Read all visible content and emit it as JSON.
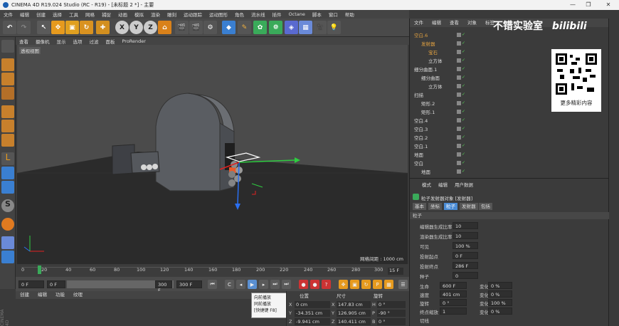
{
  "window": {
    "title": "CINEMA 4D R19.024 Studio (RC - R19) - [未标题 2 *] - 主要"
  },
  "menubar": [
    "文件",
    "编辑",
    "创建",
    "选择",
    "工具",
    "网格",
    "捕捉",
    "动画",
    "模拟",
    "渲染",
    "雕刻",
    "运动跟踪",
    "运动图形",
    "角色",
    "流水线",
    "插件",
    "Octane",
    "脚本",
    "窗口",
    "帮助"
  ],
  "toolbar": {
    "axis_x": "X",
    "axis_y": "Y",
    "axis_z": "Z"
  },
  "viewport": {
    "menu": [
      "查看",
      "摄像机",
      "显示",
      "选项",
      "过滤",
      "面板",
      "ProRender"
    ],
    "label": "透视视图",
    "grid_info": "网格间距 : 1000 cm"
  },
  "timeline": {
    "ticks": [
      "0",
      "20",
      "40",
      "60",
      "80",
      "100",
      "120",
      "140",
      "160",
      "180",
      "200",
      "220",
      "240",
      "260",
      "280",
      "300"
    ],
    "current": "15 F"
  },
  "transport": {
    "start": "0 F",
    "range_start": "0 F",
    "range_end": "300 F",
    "end": "300 F"
  },
  "tooltip": {
    "line1": "向前播放",
    "line2": "同前播放",
    "line3": "[快捷键 F8]"
  },
  "materials": {
    "menu": [
      "创建",
      "编辑",
      "功能",
      "纹理"
    ],
    "logo": "CINEMA 4D"
  },
  "coords": {
    "headers": {
      "pos": "位置",
      "size": "尺寸",
      "rot": "旋转"
    },
    "rows": [
      {
        "axis": "X",
        "pos": "0 cm",
        "size": "147.83 cm",
        "rlabel": "H",
        "rot": "0 °"
      },
      {
        "axis": "Y",
        "pos": "-34.351 cm",
        "size": "126.905 cm",
        "rlabel": "P",
        "rot": "-90 °"
      },
      {
        "axis": "Z",
        "pos": "-9.941 cm",
        "size": "140.411 cm",
        "rlabel": "B",
        "rot": "0 °"
      }
    ]
  },
  "objects": {
    "menu": [
      "文件",
      "编辑",
      "查看",
      "对象",
      "标签",
      "书签"
    ],
    "items": [
      {
        "name": "空白.6",
        "indent": 0
      },
      {
        "name": "发射器",
        "indent": 1
      },
      {
        "name": "宝石",
        "indent": 2
      },
      {
        "name": "立方体",
        "indent": 2
      },
      {
        "name": "细分曲面.1",
        "indent": 0
      },
      {
        "name": "细分曲面",
        "indent": 1
      },
      {
        "name": "立方体",
        "indent": 2
      },
      {
        "name": "扫描",
        "indent": 0
      },
      {
        "name": "矩形.2",
        "indent": 1
      },
      {
        "name": "矩形.1",
        "indent": 1
      },
      {
        "name": "空白.4",
        "indent": 0
      },
      {
        "name": "空白.3",
        "indent": 0
      },
      {
        "name": "空白.2",
        "indent": 0
      },
      {
        "name": "空白.1",
        "indent": 0
      },
      {
        "name": "地面",
        "indent": 0
      },
      {
        "name": "空白",
        "indent": 0
      },
      {
        "name": "地面",
        "indent": 1
      },
      {
        "name": "挤压",
        "indent": 1
      }
    ]
  },
  "watermark": {
    "text": "不错实验室",
    "brand": "bilibili",
    "qr_caption": "更多精彩内容"
  },
  "attributes": {
    "menu": [
      "模式",
      "编辑",
      "用户数据"
    ],
    "title": "粒子发射器对象 [发射器]",
    "tabs": [
      "基本",
      "坐标",
      "粒子",
      "发射器",
      "包括"
    ],
    "active_tab": "粒子",
    "section": "粒子",
    "rows": [
      {
        "label": "编辑器生成比率",
        "value": "10"
      },
      {
        "label": "渲染器生成比率",
        "value": "10"
      },
      {
        "label": "可见",
        "value": "100 %"
      },
      {
        "label": "投射起点",
        "value": "0 F"
      },
      {
        "label": "投射终点",
        "value": "286 F"
      },
      {
        "label": "种子",
        "value": "0"
      }
    ],
    "rows2": [
      {
        "label": "生命",
        "value": "600 F",
        "vlabel": "变化",
        "vval": "0 %"
      },
      {
        "label": "速度",
        "value": "401 cm",
        "vlabel": "变化",
        "vval": "0 %"
      },
      {
        "label": "旋转",
        "value": "0 °",
        "vlabel": "变化",
        "vval": "100 %"
      },
      {
        "label": "终点缩放",
        "value": "1",
        "vlabel": "变化",
        "vval": "0 %"
      }
    ],
    "extra": [
      "切线",
      "显示对象"
    ]
  }
}
